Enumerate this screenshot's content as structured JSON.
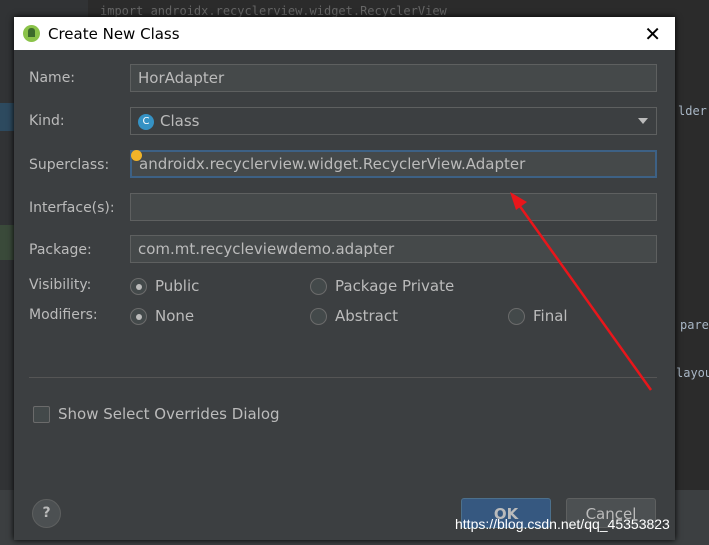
{
  "background": {
    "code_top": "import androidx.recyclerview.widget.RecyclerView",
    "code_right_1": "lder",
    "code_right_2": "pare",
    "code_right_3": "layou"
  },
  "dialog": {
    "title": "Create New Class",
    "name_label": "Name:",
    "name_value": "HorAdapter",
    "kind_label": "Kind:",
    "kind_value": "Class",
    "kind_icon": "class-c-icon",
    "superclass_label": "Superclass:",
    "superclass_value": "androidx.recyclerview.widget.RecyclerView.Adapter",
    "interfaces_label": "Interface(s):",
    "interfaces_value": "",
    "package_label": "Package:",
    "package_value": "com.mt.recycleviewdemo.adapter",
    "visibility_label": "Visibility:",
    "visibility_options": [
      "Public",
      "Package Private"
    ],
    "visibility_selected": "Public",
    "modifiers_label": "Modifiers:",
    "modifiers_options": [
      "None",
      "Abstract",
      "Final"
    ],
    "modifiers_selected": "None",
    "show_overrides_label": "Show Select Overrides Dialog",
    "show_overrides_checked": false,
    "help_label": "?",
    "ok_label": "OK",
    "cancel_label": "Cancel"
  },
  "annotation": {
    "arrow_color": "#e8161b"
  },
  "watermark": "https://blog.csdn.net/qq_45353823"
}
